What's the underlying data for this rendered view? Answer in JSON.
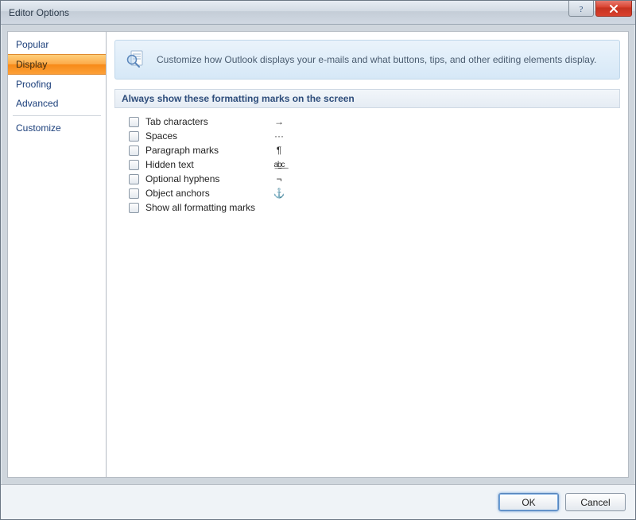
{
  "window": {
    "title": "Editor Options"
  },
  "sidebar": {
    "items": [
      {
        "label": "Popular"
      },
      {
        "label": "Display"
      },
      {
        "label": "Proofing"
      },
      {
        "label": "Advanced"
      },
      {
        "label": "Customize"
      }
    ],
    "selected_index": 1
  },
  "banner": {
    "text": "Customize how Outlook displays your e-mails and what buttons, tips, and other editing elements display."
  },
  "section": {
    "header": "Always show these formatting marks on the screen",
    "options": [
      {
        "label": "Tab characters",
        "symbol": "→",
        "checked": false
      },
      {
        "label": "Spaces",
        "symbol": "···",
        "checked": false
      },
      {
        "label": "Paragraph marks",
        "symbol": "¶",
        "checked": false
      },
      {
        "label": "Hidden text",
        "symbol": "a͟b͟c͟",
        "checked": false
      },
      {
        "label": "Optional hyphens",
        "symbol": "¬",
        "checked": false
      },
      {
        "label": "Object anchors",
        "symbol": "⚓",
        "checked": false
      },
      {
        "label": "Show all formatting marks",
        "symbol": "",
        "checked": false
      }
    ]
  },
  "buttons": {
    "ok": "OK",
    "cancel": "Cancel"
  }
}
